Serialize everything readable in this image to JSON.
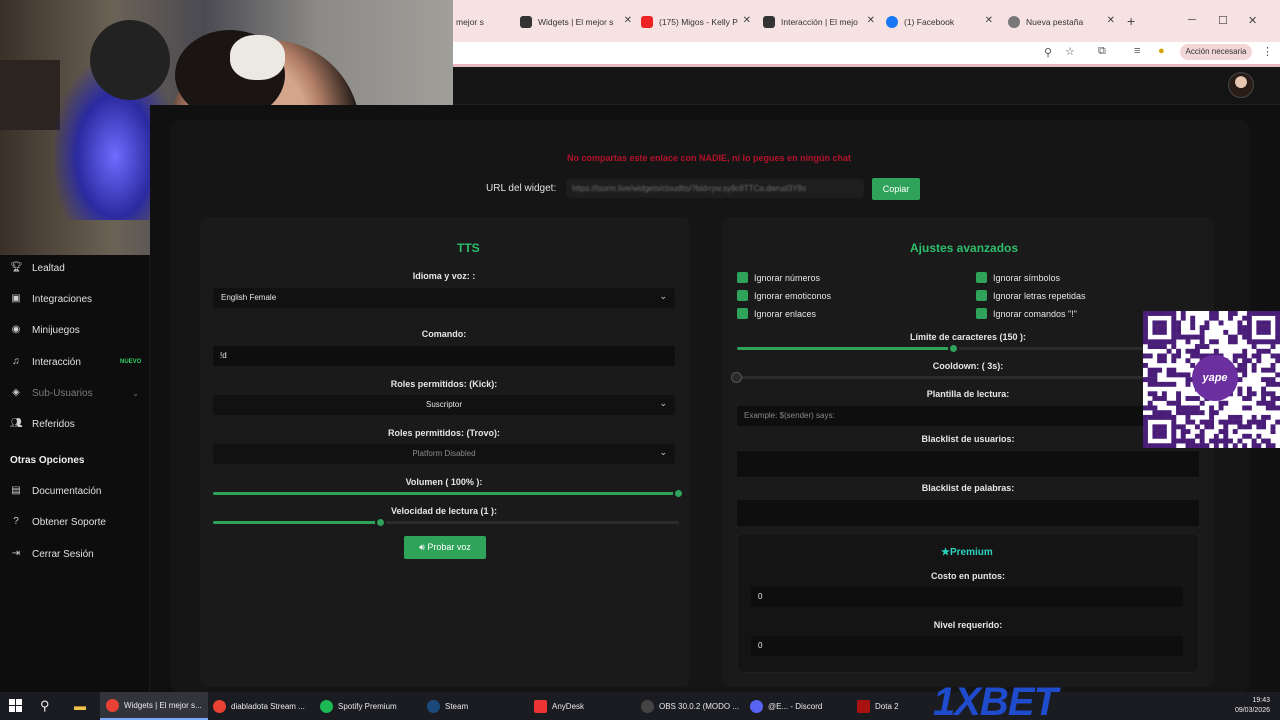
{
  "browser": {
    "tabs": [
      {
        "label": "mejor s",
        "partial": true
      },
      {
        "label": "Widgets | El mejor s"
      },
      {
        "label": "(175) Migos - Kelly P"
      },
      {
        "label": "Interacción | El mejo"
      },
      {
        "label": "(1) Facebook"
      },
      {
        "label": "Nueva pestaña"
      }
    ],
    "new_tab": "+",
    "window_controls": {
      "minimize": "─",
      "maximize": "☐",
      "close": "✕"
    },
    "action_button": "Acción necesaria"
  },
  "sidebar": {
    "items": [
      {
        "label": "Lealtad",
        "icon": "trophy-icon"
      },
      {
        "label": "Integraciones",
        "icon": "square-icon"
      },
      {
        "label": "Minijuegos",
        "icon": "gamepad-icon"
      },
      {
        "label": "Interacción",
        "icon": "music-icon",
        "badge": "NUEVO"
      },
      {
        "label": "Sub-Usuarios",
        "icon": "layers-icon",
        "disabled": true
      },
      {
        "label": "Referidos",
        "icon": "users-icon"
      }
    ],
    "section_title": "Otras Opciones",
    "other_items": [
      {
        "label": "Documentación",
        "icon": "doc-icon"
      },
      {
        "label": "Obtener Soporte",
        "icon": "help-icon"
      },
      {
        "label": "Cerrar Sesión",
        "icon": "logout-icon"
      }
    ]
  },
  "widget": {
    "warning": "No compartas este enlace con NADIE, ni lo pegues en ningún chat",
    "url_label": "URL del widget:",
    "url_value": "https://tsorm.live/widgets/cloudtts/?bid=yw.sy8c8TTCa.dwrud3Y8s",
    "copy_button": "Copiar"
  },
  "tts": {
    "title": "TTS",
    "language_label": "Idioma y voz: :",
    "language_value": "English Female",
    "command_label": "Comando:",
    "command_value": "!d",
    "roles_kick_label": "Roles permitidos: (Kick):",
    "roles_kick_value": "Suscriptor",
    "roles_trovo_label": "Roles permitidos: (Trovo):",
    "roles_trovo_value": "Platform Disabled",
    "volume_label": "Volumen ( 100% ):",
    "volume_fraction": 1.0,
    "speed_label": "Velocidad de lectura (1 ):",
    "speed_fraction": 0.36,
    "test_button": "Probar voz"
  },
  "advanced": {
    "title": "Ajustes avanzados",
    "checkboxes": [
      "Ignorar números",
      "Ignorar emoticonos",
      "Ignorar enlaces",
      "Ignorar símbolos",
      "Ignorar letras repetidas",
      "Ignorar comandos \"!\""
    ],
    "char_limit_label": "Límite de caracteres (150 ):",
    "char_limit_fraction": 0.47,
    "cooldown_label": "Cooldown: ( 3s):",
    "cooldown_fraction": 0.0,
    "template_label": "Plantilla de lectura:",
    "template_placeholder": "Example: $(sender) says:",
    "blacklist_users_label": "Blacklist de usuarios:",
    "blacklist_words_label": "Blacklist de palabras:",
    "premium_title": "Premium",
    "cost_label": "Costo en puntos:",
    "cost_value": "0",
    "level_label": "Nivel requerido:",
    "level_value": "0"
  },
  "qr": {
    "logo_text": "yape"
  },
  "overlay_brand": "1XBET",
  "taskbar": {
    "apps": [
      {
        "label": "Widgets | El mejor s...",
        "active": true
      },
      {
        "label": "diabladota Stream ..."
      },
      {
        "label": "Spotify Premium"
      },
      {
        "label": "Steam"
      },
      {
        "label": "AnyDesk"
      },
      {
        "label": "OBS 30.0.2 (MODO ..."
      },
      {
        "label": "@E... - Discord"
      },
      {
        "label": "Dota 2"
      }
    ],
    "time": "19:43",
    "date": "09/03/2026"
  },
  "colors": {
    "accent": "#2fa35a",
    "title_green": "#2dbf6c",
    "warning_red": "#b3122a",
    "premium_teal": "#2dd4bf"
  }
}
